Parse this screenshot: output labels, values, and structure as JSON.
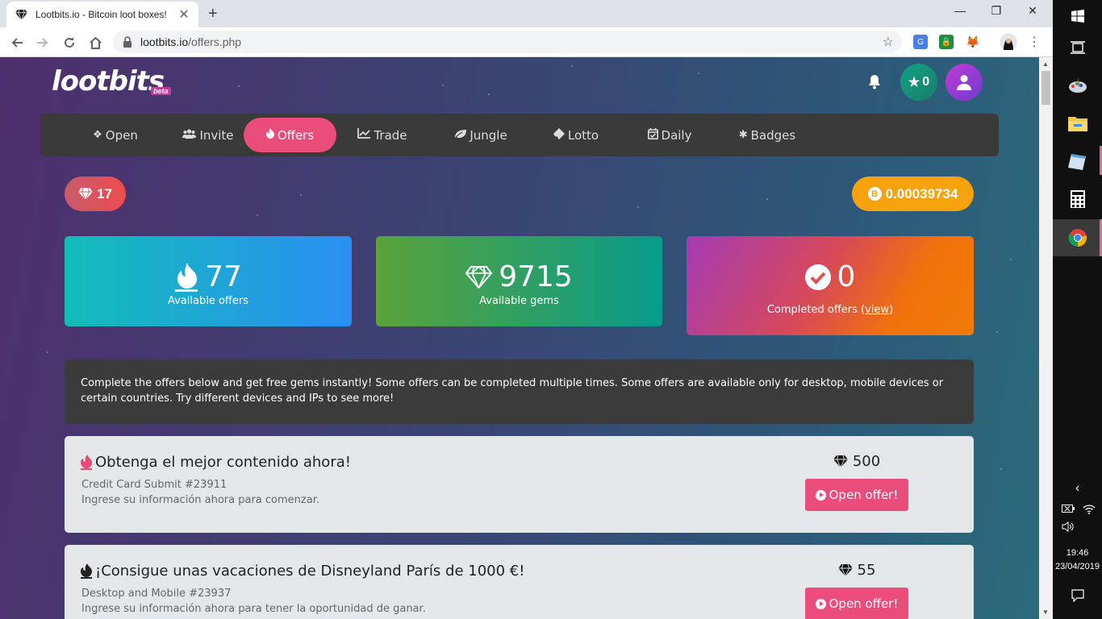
{
  "browser": {
    "tab_title": "Lootbits.io - Bitcoin loot boxes!",
    "tab_close": "✕",
    "new_tab": "+",
    "win_min": "—",
    "win_max": "❐",
    "win_close": "✕",
    "url_host": "lootbits.io",
    "url_path": "/offers.php"
  },
  "header": {
    "logo": "lootbits",
    "beta": "beta",
    "stars": "0"
  },
  "menu": [
    {
      "label": "Open",
      "icon": "dropbox-icon",
      "glyph": "❖"
    },
    {
      "label": "Invite",
      "icon": "users-icon",
      "glyph": "👥"
    },
    {
      "label": "Offers",
      "icon": "fire-icon",
      "glyph": "🔥"
    },
    {
      "label": "Trade",
      "icon": "chart-line-icon",
      "glyph": "📈"
    },
    {
      "label": "Jungle",
      "icon": "leaf-icon",
      "glyph": "🍃"
    },
    {
      "label": "Lotto",
      "icon": "ticket-icon",
      "glyph": "🎫"
    },
    {
      "label": "Daily",
      "icon": "calendar-check-icon",
      "glyph": "📅"
    },
    {
      "label": "Badges",
      "icon": "asterisk-icon",
      "glyph": "✱"
    }
  ],
  "balances": {
    "gems": "17",
    "btc": "0.00039734",
    "btc_symbol": "B"
  },
  "stats": {
    "offers_count": "77",
    "offers_label": "Available offers",
    "gems_count": "9715",
    "gems_label": "Available gems",
    "completed_count": "0",
    "completed_label": "Completed offers (",
    "completed_link": "view",
    "completed_close": ")"
  },
  "info_text": "Complete the offers below and get free gems instantly! Some offers can be completed multiple times. Some offers are available only for desktop, mobile devices or certain countries. Try different devices and IPs to see more!",
  "offers": [
    {
      "title": "Obtenga el mejor contenido ahora!",
      "category": "Credit Card Submit #23911",
      "description": "Ingrese su información ahora para comenzar.",
      "reward": "500",
      "button": "Open offer!",
      "fire_color": "#e84a78"
    },
    {
      "title": "¡Consigue unas vacaciones de Disneyland París de 1000 €!",
      "category": "Desktop and Mobile #23937",
      "description": "Ingrese su información ahora para tener la oportunidad de ganar.",
      "reward": "55",
      "button": "Open offer!",
      "fire_color": "#222222"
    }
  ],
  "taskbar": {
    "time": "19:46",
    "date": "23/04/2019"
  },
  "colors": {
    "accent": "#ea4c7b",
    "btc": "#f5a20c"
  }
}
